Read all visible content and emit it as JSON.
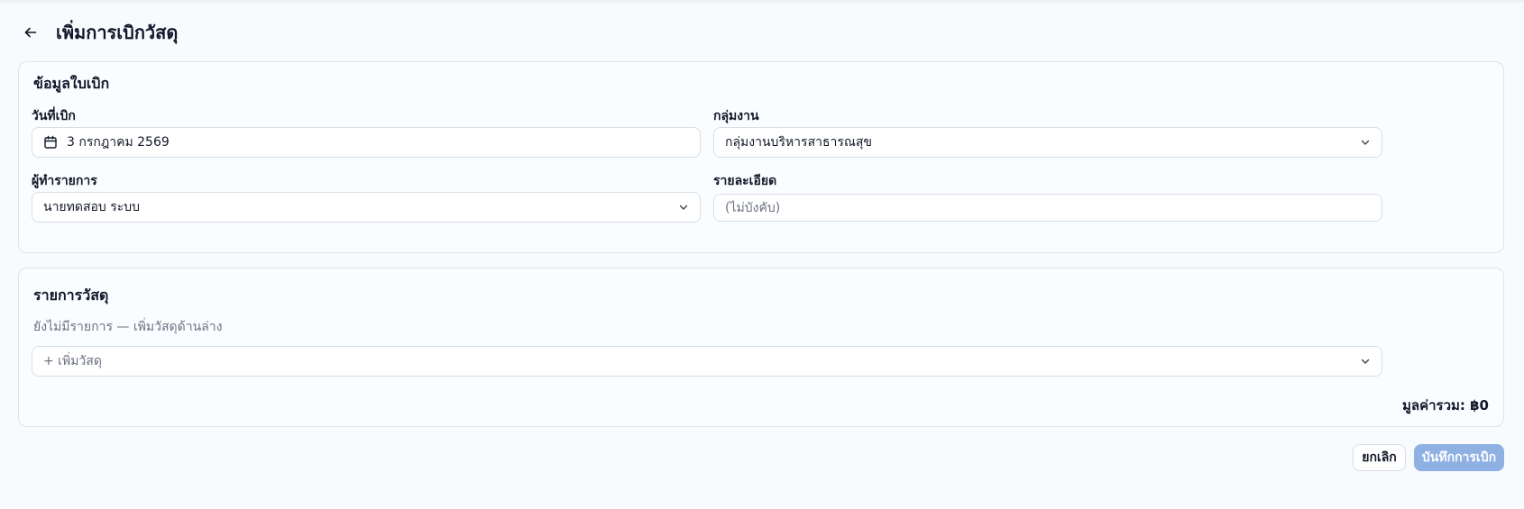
{
  "header": {
    "back_icon": "arrow-left-icon",
    "title": "เพิ่มการเบิกวัสดุ"
  },
  "requisition_info": {
    "section_title": "ข้อมูลใบเบิก",
    "date": {
      "label": "วันที่เบิก",
      "value": "3 กรกฎาคม 2569",
      "icon": "calendar-icon"
    },
    "work_group": {
      "label": "กลุ่มงาน",
      "selected": "กลุ่มงานบริหารสาธารณสุข",
      "icon": "chevron-down-icon"
    },
    "requester": {
      "label": "ผู้ทำรายการ",
      "selected": "นายทดสอบ ระบบ",
      "icon": "chevron-down-icon"
    },
    "details": {
      "label": "รายละเอียด",
      "value": "",
      "placeholder": "(ไม่บังคับ)"
    }
  },
  "items": {
    "section_title": "รายการวัสดุ",
    "empty_message": "ยังไม่มีรายการ — เพิ่มวัสดุด้านล่าง",
    "add_item_label": "+ เพิ่มวัสดุ",
    "total_text": "มูลค่ารวม: ฿0"
  },
  "actions": {
    "cancel_label": "ยกเลิก",
    "save_label": "บันทึกการเบิก"
  },
  "colors": {
    "background": "#f8fbfd",
    "card_border": "#dde3ea",
    "primary_disabled": "#8fb0e3",
    "muted_text": "#6b7280"
  }
}
